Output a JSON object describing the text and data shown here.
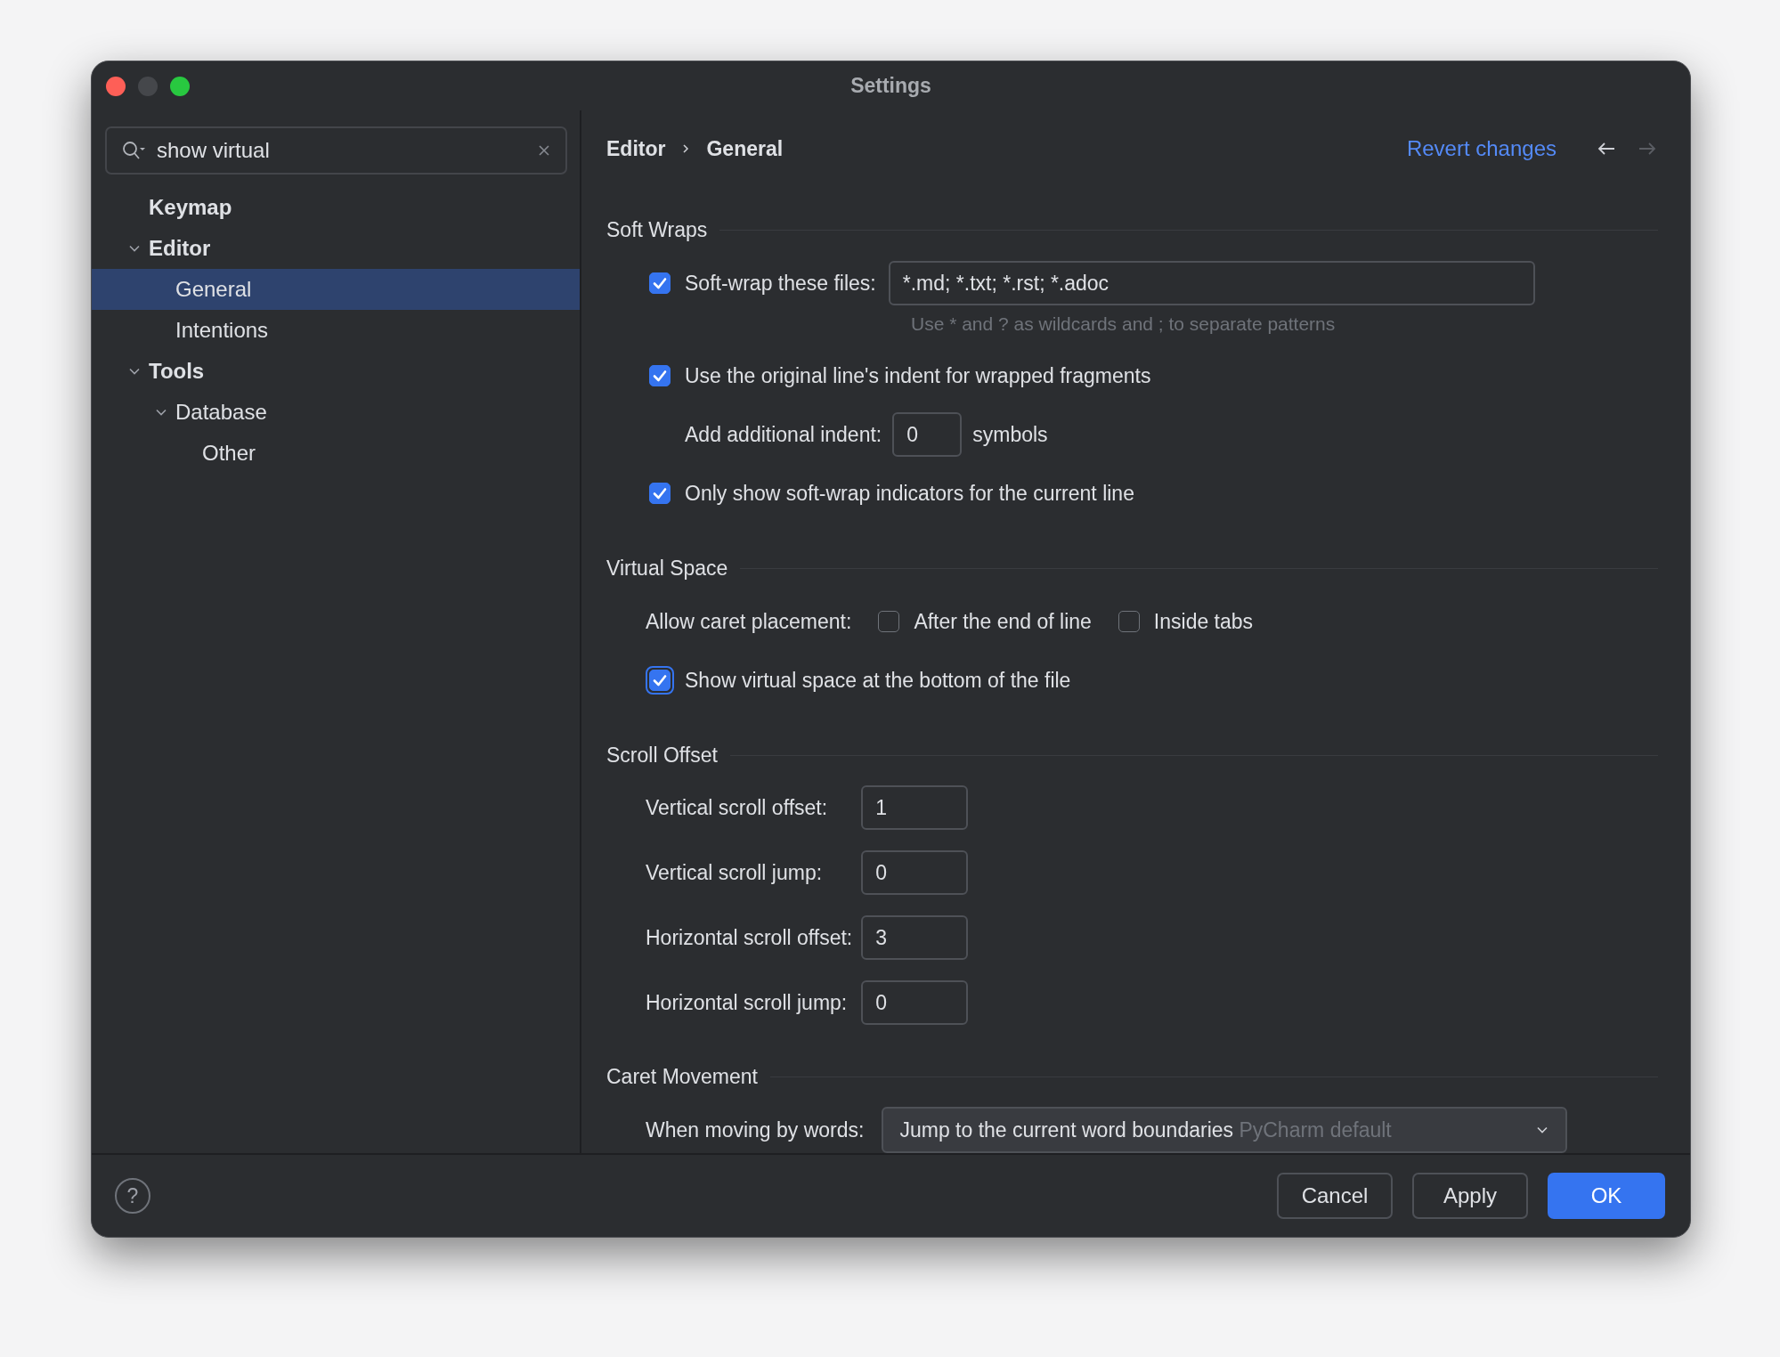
{
  "window": {
    "title": "Settings"
  },
  "search": {
    "value": "show virtual"
  },
  "tree": [
    {
      "label": "Keymap",
      "selected": false
    },
    {
      "label": "Editor",
      "expanded": true,
      "selected": false,
      "children": [
        {
          "label": "General",
          "selected": true
        },
        {
          "label": "Intentions",
          "selected": false
        }
      ]
    },
    {
      "label": "Tools",
      "expanded": true,
      "selected": false,
      "children": [
        {
          "label": "Database",
          "expanded": true,
          "selected": false,
          "children": [
            {
              "label": "Other",
              "selected": false
            }
          ]
        }
      ]
    }
  ],
  "breadcrumb": [
    "Editor",
    "General"
  ],
  "revert_link": "Revert changes",
  "nav": [
    {
      "kind": "back",
      "disabled": false
    },
    {
      "kind": "forward",
      "disabled": true
    }
  ],
  "sections": [
    {
      "title": "Soft Wraps",
      "rows": [
        {
          "kind": "checkbox-field",
          "label": "Soft-wrap these files:",
          "checked": true,
          "focused": false,
          "value": "*.md; *.txt; *.rst; *.adoc",
          "hint": "Use * and ? as wildcards and ; to separate patterns"
        },
        {
          "kind": "checkbox",
          "label": "Use the original line's indent for wrapped fragments",
          "checked": true,
          "focused": false
        },
        {
          "kind": "indent-number",
          "label": "Add additional indent:",
          "value": "0",
          "suffix": "symbols"
        },
        {
          "kind": "checkbox",
          "label": "Only show soft-wrap indicators for the current line",
          "checked": true,
          "focused": false
        }
      ]
    },
    {
      "title": "Virtual Space",
      "rows": [
        {
          "kind": "checkbox-group",
          "label": "Allow caret placement:",
          "options": [
            {
              "label": "After the end of line",
              "checked": false,
              "focused": false
            },
            {
              "label": "Inside tabs",
              "checked": false,
              "focused": false
            }
          ]
        },
        {
          "kind": "checkbox",
          "label": "Show virtual space at the bottom of the file",
          "checked": true,
          "focused": true
        }
      ]
    },
    {
      "title": "Scroll Offset",
      "rows": [
        {
          "kind": "number",
          "label": "Vertical scroll offset:",
          "value": "1"
        },
        {
          "kind": "number",
          "label": "Vertical scroll jump:",
          "value": "0"
        },
        {
          "kind": "number",
          "label": "Horizontal scroll offset:",
          "value": "3"
        },
        {
          "kind": "number",
          "label": "Horizontal scroll jump:",
          "value": "0"
        }
      ]
    },
    {
      "title": "Caret Movement",
      "rows": [
        {
          "kind": "dropdown",
          "label": "When moving by words:",
          "value": "Jump to the current word boundaries",
          "note": "PyCharm default"
        }
      ]
    }
  ],
  "help": "?",
  "buttons": [
    {
      "label": "Cancel",
      "kind": "secondary"
    },
    {
      "label": "Apply",
      "kind": "secondary"
    },
    {
      "label": "OK",
      "kind": "primary"
    }
  ]
}
